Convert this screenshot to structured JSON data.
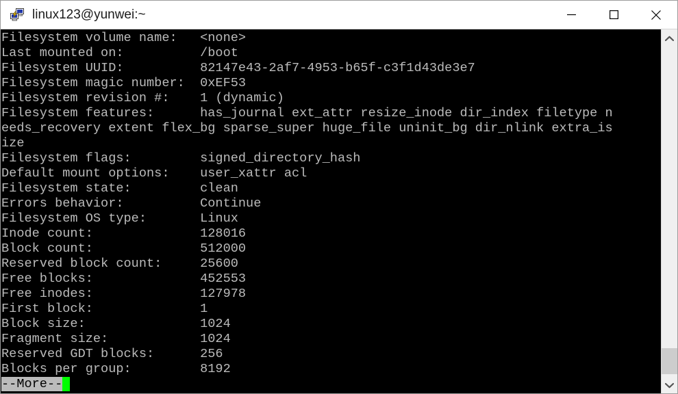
{
  "window": {
    "title": "linux123@yunwei:~",
    "icon": "putty-terminal-icon",
    "controls": {
      "minimize_label": "Minimize",
      "maximize_label": "Maximize",
      "close_label": "Close"
    }
  },
  "terminal": {
    "foreground_color": "#bbbbbb",
    "background_color": "#000000",
    "cursor_color": "#00ff00",
    "lines": [
      "Filesystem volume name:   <none>",
      "Last mounted on:          /boot",
      "Filesystem UUID:          82147e43-2af7-4953-b65f-c3f1d43de3e7",
      "Filesystem magic number:  0xEF53",
      "Filesystem revision #:    1 (dynamic)",
      "Filesystem features:      has_journal ext_attr resize_inode dir_index filetype n",
      "eeds_recovery extent flex_bg sparse_super huge_file uninit_bg dir_nlink extra_is",
      "ize",
      "Filesystem flags:         signed_directory_hash ",
      "Default mount options:    user_xattr acl",
      "Filesystem state:         clean",
      "Errors behavior:          Continue",
      "Filesystem OS type:       Linux",
      "Inode count:              128016",
      "Block count:              512000",
      "Reserved block count:     25600",
      "Free blocks:              452553",
      "Free inodes:              127978",
      "First block:              1",
      "Block size:               1024",
      "Fragment size:            1024",
      "Reserved GDT blocks:      256",
      "Blocks per group:         8192"
    ],
    "prompt": "--More--",
    "cursor": " "
  },
  "scrollbar": {
    "up_arrow": "chevron-up-icon",
    "down_arrow": "chevron-down-icon",
    "thumb_label": "scrollbar-thumb"
  }
}
